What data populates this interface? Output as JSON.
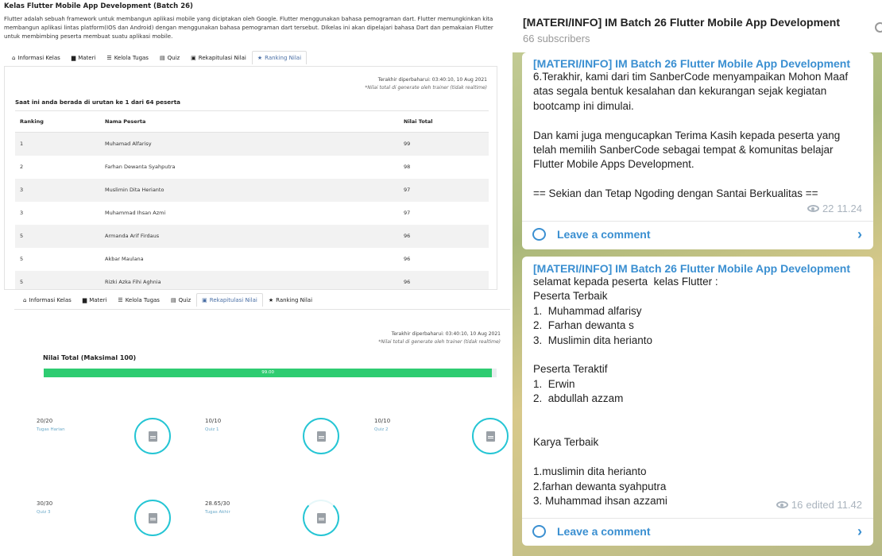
{
  "course": {
    "title": "Kelas Flutter Mobile App Development (Batch 26)",
    "description": "Flutter adalah sebuah framework untuk membangun aplikasi mobile yang diciptakan oleh Google. Flutter menggunakan bahasa pemograman dart. Flutter memungkinkan kita membangun aplikasi lintas platform(IOS dan Android) dengan menggunakan bahasa pemograman dart tersebut. DIkelas ini akan dipelajari bahasa Dart dan pemakaian Flutter untuk membimbing peserta membuat suatu aplikasi mobile."
  },
  "tabs": [
    {
      "label": "Informasi Kelas",
      "icon": "home-icon"
    },
    {
      "label": "Materi",
      "icon": "book-icon"
    },
    {
      "label": "Kelola Tugas",
      "icon": "list-icon"
    },
    {
      "label": "Quiz",
      "icon": "quiz-icon"
    },
    {
      "label": "Rekapitulasi Nilai",
      "icon": "clipboard-icon"
    },
    {
      "label": "Ranking Nilai",
      "icon": "star-icon"
    }
  ],
  "ranking": {
    "updated": "Terakhir diperbaharui: 03:40:10, 10 Aug 2021",
    "note": "*Nilai total di generate oleh trainer (tidak realtime)",
    "headline": "Saat ini anda berada di urutan ke 1 dari 64 peserta",
    "headers": [
      "Ranking",
      "Nama Peserta",
      "Nilai Total"
    ],
    "rows": [
      [
        "1",
        "Muhamad Alfarisy",
        "99"
      ],
      [
        "2",
        "Farhan Dewanta Syahputra",
        "98"
      ],
      [
        "3",
        "Muslimin Dita Herianto",
        "97"
      ],
      [
        "3",
        "Muhammad Ihsan Azmi",
        "97"
      ],
      [
        "5",
        "Armanda Arif Firdaus",
        "96"
      ],
      [
        "5",
        "Akbar Maulana",
        "96"
      ],
      [
        "5",
        "Rizki Azka Fihi Aghnia",
        "96"
      ]
    ]
  },
  "rekap": {
    "updated": "Terakhir diperbaharui: 03:40:10, 10 Aug 2021",
    "note": "*Nilai total di generate oleh trainer (tidak realtime)",
    "title": "Nilai Total (Maksimal 100)",
    "total_label": "99.00",
    "total_fraction": 0.99,
    "items": [
      {
        "score": "20/20",
        "label": "Tugas Harian"
      },
      {
        "score": "10/10",
        "label": "Quiz 1"
      },
      {
        "score": "10/10",
        "label": "Quiz 2"
      },
      {
        "score": "30/30",
        "label": "Quiz 3"
      },
      {
        "score": "28.65/30",
        "label": "Tugas Akhir"
      }
    ]
  },
  "telegram": {
    "channel": "[MATERI/INFO] IM Batch 26 Flutter Mobile App Development",
    "subscribers": "66 subscribers",
    "messages": [
      {
        "sender": "[MATERI/INFO] IM Batch 26 Flutter Mobile App Development",
        "lines": [
          "6.Terakhir, kami dari tim SanberCode menyampaikan Mohon Maaf",
          "atas segala bentuk kesalahan dan kekurangan sejak kegiatan",
          "bootcamp ini dimulai.",
          "",
          "Dan kami juga mengucapkan Terima Kasih kepada peserta yang",
          "telah memilih SanberCode sebagai tempat & komunitas belajar",
          "Flutter Mobile Apps Development.",
          "",
          "== Sekian dan Tetap Ngoding dengan Santai Berkualitas =="
        ],
        "views": "22",
        "time": "11.24",
        "comment_label": "Leave a comment"
      },
      {
        "sender": "[MATERI/INFO] IM Batch 26 Flutter Mobile App Development",
        "lines": [
          "selamat kepada peserta  kelas Flutter :",
          "Peserta Terbaik",
          "1.  Muhammad alfarisy",
          "2.  Farhan dewanta s",
          "3.  Muslimin dita herianto",
          "",
          "Peserta Teraktif",
          "1.  Erwin",
          "2.  abdullah azzam",
          "",
          "",
          "Karya Terbaik",
          "",
          "1.muslimin dita herianto",
          "2.farhan dewanta syahputra",
          "3. Muhammad ihsan azzami"
        ],
        "views": "16",
        "time": "edited 11.42",
        "comment_label": "Leave a comment"
      }
    ]
  }
}
